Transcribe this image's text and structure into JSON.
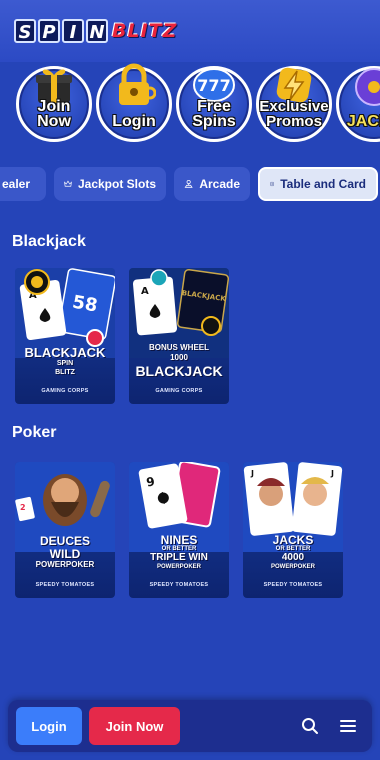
{
  "brand": {
    "logo_spin": [
      "S",
      "P",
      "I",
      "N"
    ],
    "logo_blitz": "BLITZ"
  },
  "quick_links": [
    {
      "label": "Join Now",
      "icon": "gift-icon"
    },
    {
      "label": "Login",
      "icon": "padlock-icon"
    },
    {
      "label": "Free Spins",
      "icon": "slot-reel-icon"
    },
    {
      "label": "Exclusive Promos",
      "icon": "lightning-icon"
    },
    {
      "label": "JACKP",
      "icon": "jackpot-wheel-icon"
    }
  ],
  "categories": [
    {
      "label": "ealer",
      "icon": ""
    },
    {
      "label": "Jackpot Slots",
      "icon": "crown-icon"
    },
    {
      "label": "Arcade",
      "icon": "arcade-icon"
    },
    {
      "label": "Table and Card",
      "icon": "card-icon",
      "active": true
    }
  ],
  "sections": [
    {
      "title": "Blackjack",
      "games": [
        {
          "title_lines": [
            "BLACKJACK",
            "SPIN",
            "BLITZ"
          ],
          "provider": "GAMING CORPS"
        },
        {
          "title_lines": [
            "BONUS WHEEL",
            "1000",
            "BLACKJACK"
          ],
          "provider": "GAMING CORPS"
        }
      ]
    },
    {
      "title": "Poker",
      "games": [
        {
          "title_lines": [
            "DEUCES",
            "WILD",
            "POWERPOKER"
          ],
          "provider": "SPEEDY TOMATOES"
        },
        {
          "title_lines": [
            "NINES",
            "OR BETTER",
            "TRIPLE WIN",
            "POWERPOKER"
          ],
          "provider": "SPEEDY TOMATOES"
        },
        {
          "title_lines": [
            "JACKS",
            "OR BETTER",
            "4000",
            "POWERPOKER"
          ],
          "provider": "SPEEDY TOMATOES"
        }
      ]
    }
  ],
  "bottom_nav": {
    "login_label": "Login",
    "join_label": "Join Now",
    "search_icon": "search-icon",
    "menu_icon": "hamburger-menu-icon"
  },
  "colors": {
    "background": "#2544b8",
    "login_button": "#3b7dfa",
    "join_button": "#e5294a",
    "bottom_bar": "#1d2e8f",
    "active_chip": "#dfe6f7"
  }
}
